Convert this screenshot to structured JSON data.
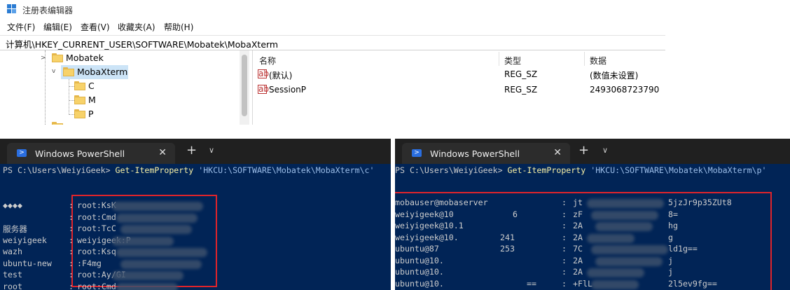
{
  "regedit": {
    "title": "注册表编辑器",
    "menu": [
      "文件(F)",
      "编辑(E)",
      "查看(V)",
      "收藏夹(A)",
      "帮助(H)"
    ],
    "address": "计算机\\HKEY_CURRENT_USER\\SOFTWARE\\Mobatek\\MobaXterm",
    "tree": [
      "Mobatek",
      "MobaXterm",
      "C",
      "M",
      "P"
    ],
    "columns": [
      "名称",
      "类型",
      "数据"
    ],
    "rows": [
      {
        "name": "(默认)",
        "type": "REG_SZ",
        "data": "(数值未设置)"
      },
      {
        "name": "SessionP",
        "type": "REG_SZ",
        "data": "2493068723790"
      }
    ],
    "string_icon_label": "ab"
  },
  "ps_left": {
    "tab_title": "Windows PowerShell",
    "close": "✕",
    "new_tab": "+",
    "dropdown": "∨",
    "prompt": "PS C:\\Users\\WeiyiGeek> ",
    "command": "Get-ItemProperty",
    "arg": " 'HKCU:\\SOFTWARE\\Mobatek\\MobaXterm\\c'",
    "rows": [
      {
        "key": "◆◆◆◆",
        "value": "root:KsK"
      },
      {
        "key": "",
        "value": "root:Cmd"
      },
      {
        "key": "服务器",
        "value": "root:TcC"
      },
      {
        "key": "weiyigeek",
        "value": "weiyigeek:P"
      },
      {
        "key": "wazh",
        "value": "root:Ksq"
      },
      {
        "key": "ubuntu-new",
        "value": ":F4mg"
      },
      {
        "key": "test",
        "value": "root:Ay/GI"
      },
      {
        "key": "root",
        "value": "root:Cmd"
      }
    ]
  },
  "ps_right": {
    "tab_title": "Windows PowerShell",
    "close": "✕",
    "new_tab": "+",
    "dropdown": "∨",
    "prompt": "PS C:\\Users\\WeiyiGeek> ",
    "command": "Get-ItemProperty",
    "arg": " 'HKCU:\\SOFTWARE\\Mobatek\\MobaXterm\\p'",
    "rows": [
      {
        "key": "mobauser@mobaserver",
        "value": "jt",
        "tail": "5jzJr9p35ZUt8"
      },
      {
        "key": "weiyigeek@10",
        "value": "zF",
        "tail": "8="
      },
      {
        "key": "weiyigeek@10.1",
        "value": "2A",
        "tail": "hg"
      },
      {
        "key": "weiyigeek@10.",
        "value": "2A",
        "tail": "g"
      },
      {
        "key": "ubuntu@87",
        "value": "7C",
        "tail": "ld1g=="
      },
      {
        "key": "ubuntu@10.",
        "value": "2A",
        "tail": "j"
      },
      {
        "key": "ubuntu@10.",
        "value": "2A",
        "tail": "j"
      },
      {
        "key": "ubuntu@10.",
        "value": "+FlL",
        "tail": "2l5ev9fg=="
      }
    ],
    "left_tails": [
      "6",
      "241",
      "253",
      "=="
    ]
  }
}
